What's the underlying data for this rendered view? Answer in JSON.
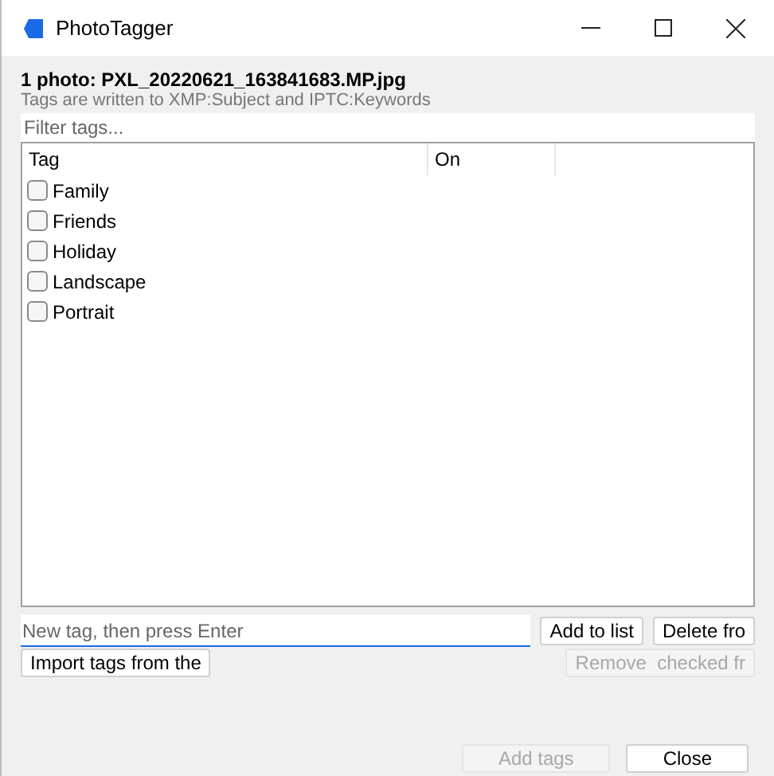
{
  "window": {
    "title": "PhotoTagger"
  },
  "header": {
    "title": "1 photo: PXL_20220621_163841683.MP.jpg",
    "subtitle": "Tags are written to XMP:Subject and IPTC:Keywords"
  },
  "filter": {
    "placeholder": "Filter tags..."
  },
  "table": {
    "columns": [
      "Tag",
      "On"
    ],
    "rows": [
      {
        "tag": "Family",
        "checked": false
      },
      {
        "tag": "Friends",
        "checked": false
      },
      {
        "tag": "Holiday",
        "checked": false
      },
      {
        "tag": "Landscape",
        "checked": false
      },
      {
        "tag": "Portrait",
        "checked": false
      }
    ]
  },
  "new_tag": {
    "placeholder": "New tag, then press Enter"
  },
  "buttons": [
    {
      "label": "Add to list",
      "disabled": false
    },
    {
      "label": "Delete fro",
      "disabled": false
    }
  ],
  "buttons_2": [
    {
      "label": "Import tags from the",
      "disabled": false
    },
    {
      "label": "Remove  checked fr",
      "disabled": true
    }
  ],
  "footer_buttons": [
    {
      "label": "Add tags",
      "disabled": true
    },
    {
      "label": "Close",
      "disabled": false
    }
  ]
}
